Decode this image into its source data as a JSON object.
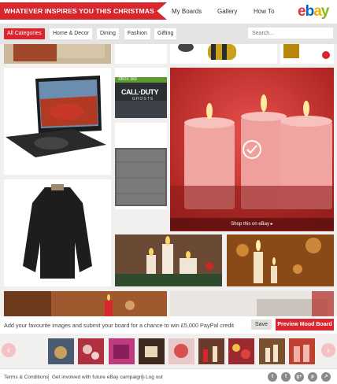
{
  "header": {
    "title": "WHATEVER INSPIRES YOU THIS CHRISTMAS",
    "nav": [
      "My Boards",
      "Gallery",
      "How To"
    ],
    "logo": {
      "e": "e",
      "b": "b",
      "a": "a",
      "y": "y"
    }
  },
  "categories": [
    "All Categories",
    "Home & Decor",
    "Dining",
    "Fashion",
    "Gifting"
  ],
  "search": {
    "placeholder": "Search..."
  },
  "tiles": {
    "xbox_label": "XBOX 360",
    "game_title": "CALL·DUTY",
    "game_subtitle": "GHOSTS",
    "game_xbox_label": "XBOX 360",
    "shop_link": "Shop this on eBay ▸"
  },
  "promo": {
    "text": "Add your favourite images and submit your board for a chance to win £5,000 PayPal credit",
    "save": "Save",
    "preview": "Preview Mood Board"
  },
  "carousel": {
    "prev": "‹",
    "next": "›"
  },
  "footer": {
    "links": [
      "Terms & Conditions",
      "Get involved with future eBay campaigns",
      "Log out"
    ],
    "social": [
      "twitter-icon",
      "facebook-icon",
      "google-plus-icon",
      "pinterest-icon",
      "share-icon"
    ],
    "social_glyphs": [
      "t",
      "f",
      "g+",
      "p",
      "↗"
    ]
  },
  "colors": {
    "accent": "#d8262c"
  }
}
